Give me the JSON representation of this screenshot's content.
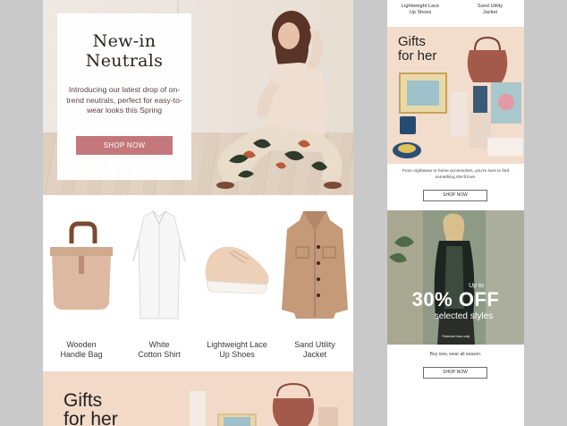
{
  "left_email": {
    "hero": {
      "title_line1": "New-in",
      "title_line2": "Neutrals",
      "text": "Introducing our latest drop of on-trend neutrals, perfect for easy-to-wear looks this Spring",
      "button": "SHOP NOW"
    },
    "products": [
      {
        "line1": "Wooden",
        "line2": "Handle Bag",
        "icon": "handbag-icon"
      },
      {
        "line1": "White",
        "line2": "Cotton Shirt",
        "icon": "shirt-icon"
      },
      {
        "line1": "Lightweight Lace",
        "line2": "Up Shoes",
        "icon": "shoe-icon"
      },
      {
        "line1": "Sand Utility",
        "line2": "Jacket",
        "icon": "jacket-icon"
      }
    ],
    "gifts_strip": {
      "line1": "Gifts",
      "line2": "for her"
    }
  },
  "right_email": {
    "top_labels": [
      {
        "line1": "Lightweight Lace",
        "line2": "Up Shoes"
      },
      {
        "line1": "Sand Utility",
        "line2": "Jacket"
      }
    ],
    "gifts": {
      "line1": "Gifts",
      "line2": "for her",
      "text": "From nightwear to home accessories, you're sure to find something she'll love.",
      "button": "SHOP NOW"
    },
    "sale": {
      "up_to": "Up to",
      "headline": "30% OFF",
      "subline": "selected styles",
      "fine_print": "*Selected lines only",
      "text": "Buy now, wear all season.",
      "button": "SHOP NOW"
    }
  },
  "colors": {
    "background": "#c9c9c9",
    "accent_button": "#c4787b",
    "peach": "#f2d9c8"
  }
}
